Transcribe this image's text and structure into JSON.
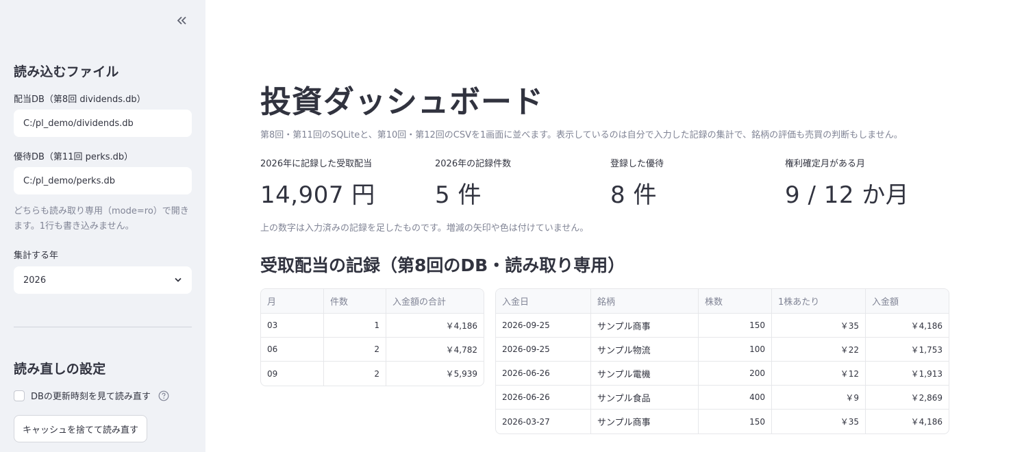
{
  "sidebar": {
    "files_heading": "読み込むファイル",
    "dividend_db": {
      "label": "配当DB（第8回 dividends.db）",
      "value": "C:/pl_demo/dividends.db"
    },
    "perks_db": {
      "label": "優待DB（第11回 perks.db）",
      "value": "C:/pl_demo/perks.db"
    },
    "readonly_caption": "どちらも読み取り専用（mode=ro）で開きます。1行も書き込みません。",
    "year": {
      "label": "集計する年",
      "value": "2026"
    },
    "reload_heading": "読み直しの設定",
    "reload_checkbox_label": "DBの更新時刻を見て読み直す",
    "clear_cache_button": "キャッシュを捨てて読み直す"
  },
  "main": {
    "title": "投資ダッシュボード",
    "subtitle": "第8回・第11回のSQLiteと、第10回・第12回のCSVを1画面に並べます。表示しているのは自分で入力した記録の集計で、銘柄の評価も売買の判断もしません。",
    "metrics": [
      {
        "label": "2026年に記録した受取配当",
        "value": "14,907 円"
      },
      {
        "label": "2026年の記録件数",
        "value": "5 件"
      },
      {
        "label": "登録した優待",
        "value": "8 件"
      },
      {
        "label": "権利確定月がある月",
        "value": "9 / 12 か月"
      }
    ],
    "metrics_note": "上の数字は入力済みの記録を足したものです。増減の矢印や色は付けていません。",
    "section_heading": "受取配当の記録（第8回のDB・読み取り専用）",
    "monthly_table": {
      "headers": [
        "月",
        "件数",
        "入金額の合計"
      ],
      "rows": [
        [
          "03",
          "1",
          "￥4,186"
        ],
        [
          "06",
          "2",
          "￥4,782"
        ],
        [
          "09",
          "2",
          "￥5,939"
        ]
      ]
    },
    "detail_table": {
      "headers": [
        "入金日",
        "銘柄",
        "株数",
        "1株あたり",
        "入金額"
      ],
      "rows": [
        [
          "2026-09-25",
          "サンプル商事",
          "150",
          "￥35",
          "￥4,186"
        ],
        [
          "2026-09-25",
          "サンプル物流",
          "100",
          "￥22",
          "￥1,753"
        ],
        [
          "2026-06-26",
          "サンプル電機",
          "200",
          "￥12",
          "￥1,913"
        ],
        [
          "2026-06-26",
          "サンプル食品",
          "400",
          "￥9",
          "￥2,869"
        ],
        [
          "2026-03-27",
          "サンプル商事",
          "150",
          "￥35",
          "￥4,186"
        ]
      ]
    }
  }
}
